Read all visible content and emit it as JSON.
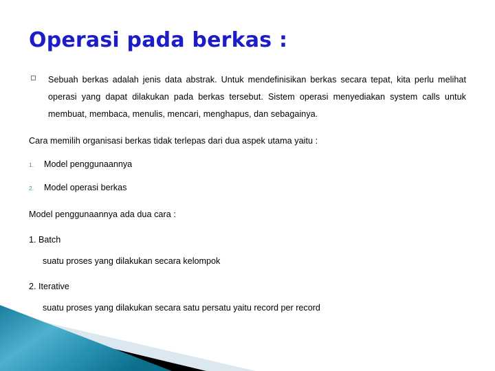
{
  "slide": {
    "title": "Operasi pada berkas :",
    "title_color": "#1d1dc7",
    "background_color": "#ffffff"
  },
  "body": {
    "bullet": {
      "marker": "hollow-square",
      "marker_color": "#5b7f9e",
      "text": "Sebuah berkas  adalah jenis data abstrak. Untuk mendefinisikan berkas secara tepat, kita perlu melihat operasi yang dapat dilakukan pada berkas tersebut. Sistem operasi menyediakan system calls untuk membuat, membaca, menulis, mencari, menghapus, dan sebagainya."
    },
    "intro_line": "Cara memilih organisasi berkas tidak terlepas dari dua aspek utama yaitu :",
    "numbered_items": [
      {
        "marker": "1.",
        "label": "Model penggunaannya"
      },
      {
        "marker": "2.",
        "label": "Model operasi berkas"
      }
    ],
    "numbered_marker_color": "#3e8ba8",
    "second_intro_line": "Model penggunaannya ada dua cara :",
    "modes": [
      {
        "heading": "1. Batch",
        "description": "suatu proses yang dilakukan secara kelompok"
      },
      {
        "heading": "2. Iterative",
        "description": "suatu proses yang dilakukan secara satu persatu yaitu record per record"
      }
    ]
  },
  "decoration": {
    "name": "bottom-left-angled-bands",
    "band_teal_start": "#1f7fa0",
    "band_teal_mid": "#4aa9c9",
    "band_teal_end": "#0f7490",
    "band_black": "#000000",
    "band_pale": "#dce8ef"
  }
}
